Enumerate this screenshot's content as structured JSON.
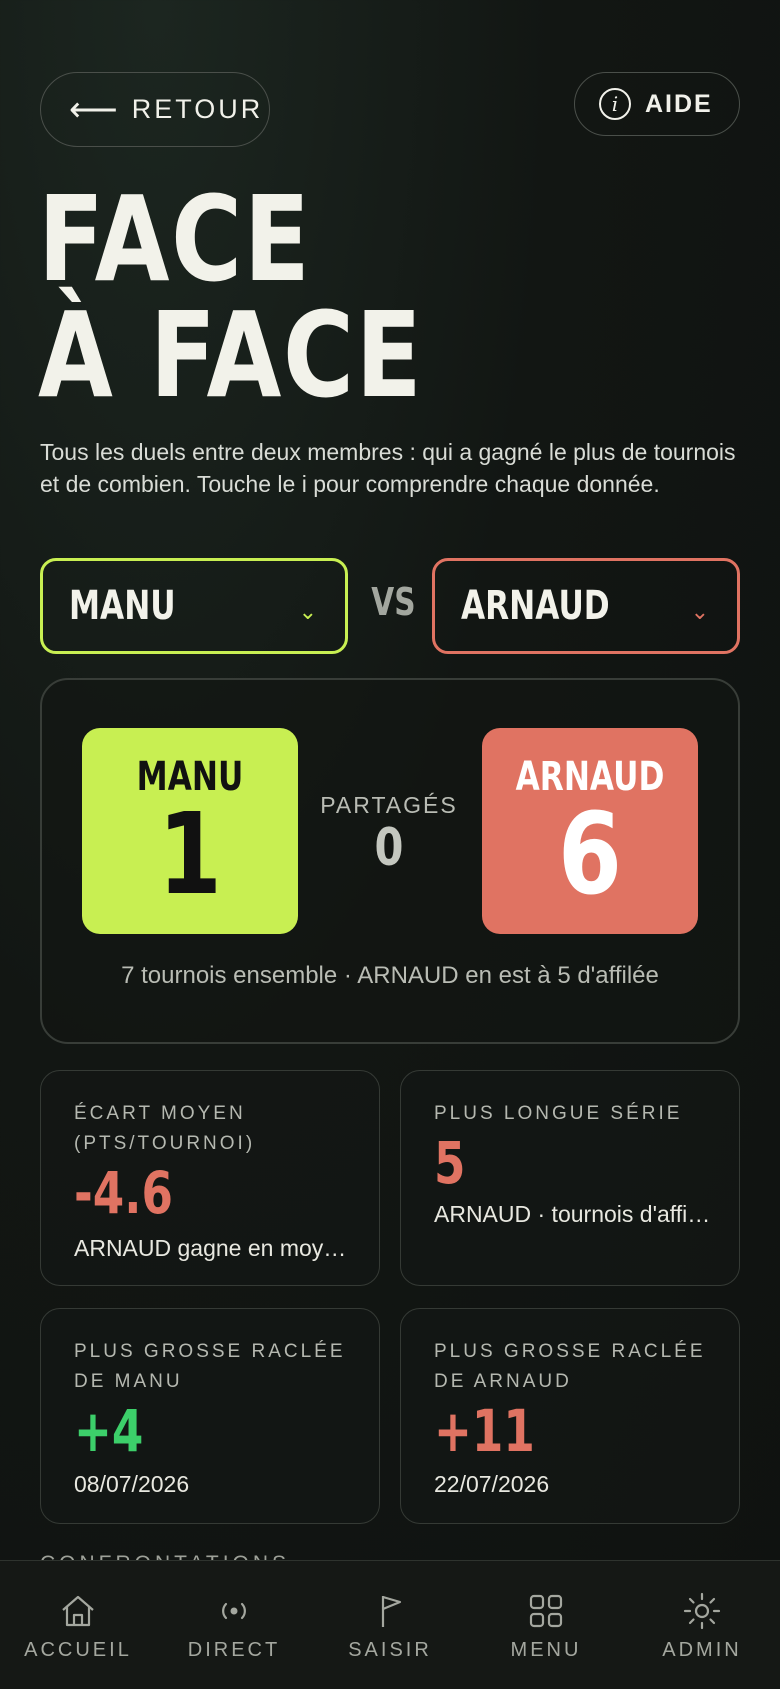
{
  "header": {
    "back_label": "RETOUR",
    "help_label": "AIDE",
    "help_icon_glyph": "i"
  },
  "title": {
    "line1": "FACE",
    "line2": "À FACE"
  },
  "intro": "Tous les duels entre deux membres : qui a gagné le plus de tournois et de combien. Touche le i pour comprendre chaque donnée.",
  "selectors": {
    "player_a": "MANU",
    "vs_label": "VS",
    "player_b": "ARNAUD",
    "chevron_glyph": "⌄"
  },
  "score": {
    "player_a_name": "MANU",
    "player_a_wins": "1",
    "shared_label": "PARTAGÉS",
    "shared_value": "0",
    "player_b_name": "ARNAUD",
    "player_b_wins": "6",
    "summary": "7 tournois ensemble · ARNAUD en est à 5 d'affilée"
  },
  "stats": [
    {
      "label": "ÉCART MOYEN (PTS/TOURNOI)",
      "value": "-4.6",
      "sub": "ARNAUD gagne en moyenne"
    },
    {
      "label": "PLUS LONGUE SÉRIE",
      "value": "5",
      "sub": "ARNAUD · tournois d'affilée"
    },
    {
      "label": "PLUS GROSSE RACLÉE DE MANU",
      "value": "+4",
      "sub": "08/07/2026"
    },
    {
      "label": "PLUS GROSSE RACLÉE DE ARNAUD",
      "value": "+11",
      "sub": "22/07/2026"
    }
  ],
  "next_section_label": "CONFRONTATIONS",
  "colors": {
    "player_a": "#c8ef52",
    "player_b": "#e07362",
    "positive": "#3ccf6a",
    "background": "#121613"
  },
  "nav": [
    {
      "label": "ACCUEIL",
      "icon": "home-icon"
    },
    {
      "label": "DIRECT",
      "icon": "broadcast-icon"
    },
    {
      "label": "SAISIR",
      "icon": "flag-icon"
    },
    {
      "label": "MENU",
      "icon": "grid-icon"
    },
    {
      "label": "ADMIN",
      "icon": "sun-gear-icon"
    }
  ]
}
